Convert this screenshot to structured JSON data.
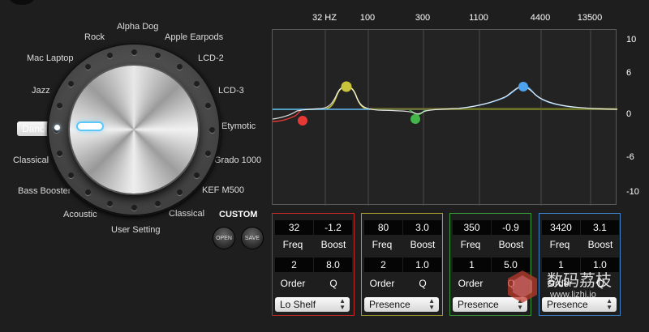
{
  "presets": {
    "labels": [
      "Alpha Dog",
      "Rock",
      "Apple Earpods",
      "Mac Laptop",
      "LCD-2",
      "Jazz",
      "LCD-3",
      "Dance",
      "Etymotic",
      "Classical",
      "Grado 1000",
      "Bass Booster",
      "KEF M500",
      "Acoustic",
      "Classical",
      "User Setting"
    ],
    "selected": "Dance",
    "custom_title": "CUSTOM",
    "open_label": "OPEN",
    "save_label": "SAVE"
  },
  "graph": {
    "freq_labels": [
      "32 HZ",
      "100",
      "300",
      "1100",
      "4400",
      "13500"
    ],
    "db_labels": [
      "10",
      "6",
      "0",
      "-6",
      "-10"
    ],
    "db_range": [
      -12,
      12
    ],
    "colors": {
      "band1": "#e53935",
      "band2": "#c9c33a",
      "band3": "#43b649",
      "band4": "#4fa3ee",
      "curve": "#ffffff"
    }
  },
  "bands": [
    {
      "freq": "32",
      "boost": "-1.2",
      "order": "2",
      "q": "8.0",
      "type": "Lo Shelf",
      "border": "#c62828"
    },
    {
      "freq": "80",
      "boost": "3.0",
      "order": "2",
      "q": "1.0",
      "type": "Presence",
      "border": "#a59d2d"
    },
    {
      "freq": "350",
      "boost": "-0.9",
      "order": "1",
      "q": "5.0",
      "type": "Presence",
      "border": "#3a9a3a"
    },
    {
      "freq": "3420",
      "boost": "3.1",
      "order": "1",
      "q": "1.0",
      "type": "Presence",
      "border": "#3f83c9"
    }
  ],
  "band_labels": {
    "freq": "Freq",
    "boost": "Boost",
    "order": "Order",
    "q": "Q"
  },
  "watermark": {
    "title": "数码荔枝",
    "url": "www.lizhi.io"
  }
}
